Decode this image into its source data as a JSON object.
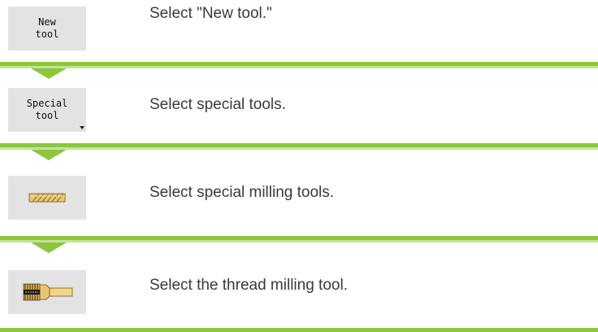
{
  "steps": [
    {
      "softkey_label": "New\ntool",
      "description": "Select \"New tool.\""
    },
    {
      "softkey_label": "Special\ntool",
      "description": "Select special tools."
    },
    {
      "softkey_icon": "special-milling-tools-icon",
      "description": "Select special milling tools."
    },
    {
      "softkey_icon": "thread-milling-tool-icon",
      "description": "Select the thread milling tool."
    }
  ],
  "colors": {
    "accent": "#8cc63f",
    "accent_light": "#c4e397",
    "softkey_bg": "#e3e3e3",
    "text": "#3a3a3a"
  }
}
